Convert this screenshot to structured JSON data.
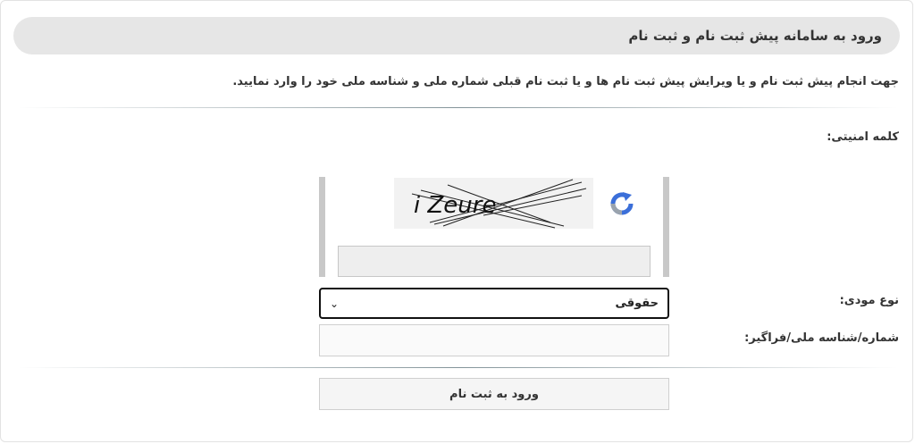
{
  "header": {
    "title": "ورود به سامانه پیش ثبت نام و ثبت نام"
  },
  "intro_text": "جهت انجام پیش ثبت نام و یا ویرایش پیش ثبت نام ها و یا ثبت نام قبلی شماره ملی و شناسه ملی خود را وارد نمایید.",
  "form": {
    "captcha_label": "کلمه امنیتی:",
    "captcha_text": "i Zeure",
    "captcha_input_value": "",
    "taxpayer_type_label": "نوع مودی:",
    "taxpayer_type_selected": "حقوقی",
    "id_label": "شماره/شناسه ملی/فراگیر:",
    "id_input_value": "",
    "submit_label": "ورود به ثبت نام"
  }
}
